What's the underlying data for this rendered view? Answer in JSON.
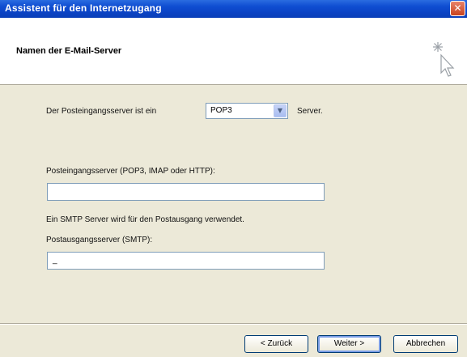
{
  "window": {
    "title": "Assistent für den Internetzugang",
    "close_symbol": "✕"
  },
  "header": {
    "title": "Namen der E-Mail-Server",
    "icon": "cursor-sparkle-icon"
  },
  "form": {
    "incoming_type_prefix": "Der Posteingangsserver ist ein",
    "incoming_type_value": "POP3",
    "incoming_type_suffix": "Server.",
    "incoming_server_label": "Posteingangsserver (POP3, IMAP oder HTTP):",
    "incoming_server_value": "",
    "smtp_info": "Ein SMTP Server wird für den Postausgang verwendet.",
    "outgoing_server_label": "Postausgangsserver (SMTP):",
    "outgoing_server_value": "_"
  },
  "buttons": {
    "back": "< Zurück",
    "next": "Weiter >",
    "cancel": "Abbrechen"
  },
  "colors": {
    "titlebar": "#0b43c4",
    "dialog_bg": "#ece9d8",
    "header_bg": "#ffffff"
  }
}
